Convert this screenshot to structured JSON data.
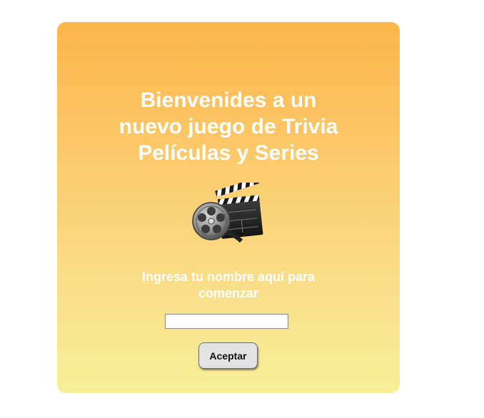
{
  "welcome": {
    "title_lines": [
      "Bienvenides a un",
      "nuevo juego de Trivia",
      "Películas y Series"
    ]
  },
  "icon": "film-reel-clapperboard-icon",
  "form": {
    "prompt_lines": [
      "Ingresa tu nombre aquí para",
      "comenzar"
    ],
    "name_value": "",
    "submit_label": "Aceptar"
  },
  "colors": {
    "card_top": "#fdb54a",
    "card_bottom": "#f8ef98",
    "text": "#ffffff",
    "button_bg": "#e3e3e3"
  }
}
